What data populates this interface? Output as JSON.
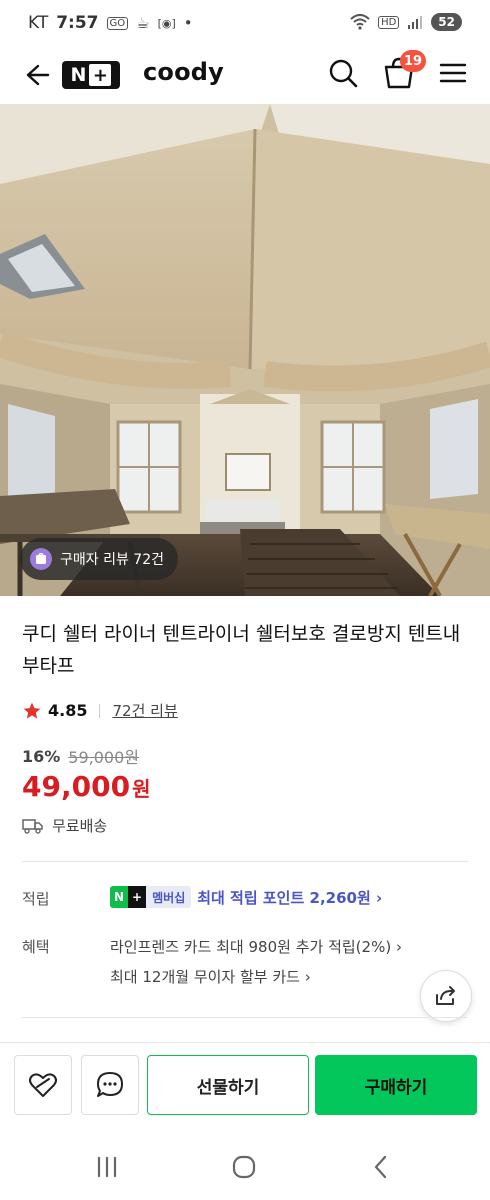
{
  "status_bar": {
    "carrier": "KT",
    "time": "7:57",
    "glyph_1": "GO",
    "glyph_2": "☕",
    "glyph_3": "[◉]",
    "dot": "•",
    "network": "HD",
    "battery": "52"
  },
  "header": {
    "brand_logo": "N+",
    "store_name": "coody",
    "cart_count": "19"
  },
  "hero": {
    "review_chip": "구매자 리뷰 72건"
  },
  "product": {
    "title": "쿠디 쉘터 라이너 텐트라이너 쉘터보호 결로방지 텐트내부타프",
    "rating": "4.85",
    "review_link": "72건 리뷰",
    "discount_pct": "16%",
    "original_price": "59,000원",
    "price": "49,000",
    "price_unit": "원",
    "shipping": "무료배송"
  },
  "points": {
    "label": "적립",
    "tag_n": "N",
    "tag_plus": "+",
    "tag_membership": "멤버십",
    "text": "최대 적립 포인트 2,260원 ›"
  },
  "benefits": {
    "label": "혜택",
    "line_1": "라인프렌즈 카드 최대 980원 추가 적립(2%) ›",
    "line_2": "최대 12개월 무이자 할부 카드 ›"
  },
  "actions": {
    "gift": "선물하기",
    "buy": "구매하기"
  },
  "colors": {
    "price_red": "#d91c22",
    "naver_green": "#03c75a",
    "badge_red": "#f5533d",
    "points_blue": "#4a55c7"
  },
  "icons": [
    "back-arrow-icon",
    "search-icon",
    "shopping-bag-icon",
    "hamburger-menu-icon",
    "star-icon",
    "delivery-truck-icon",
    "share-icon",
    "wish-heart-icon",
    "chat-bubble-icon",
    "recent-apps-icon",
    "home-icon",
    "back-icon"
  ]
}
